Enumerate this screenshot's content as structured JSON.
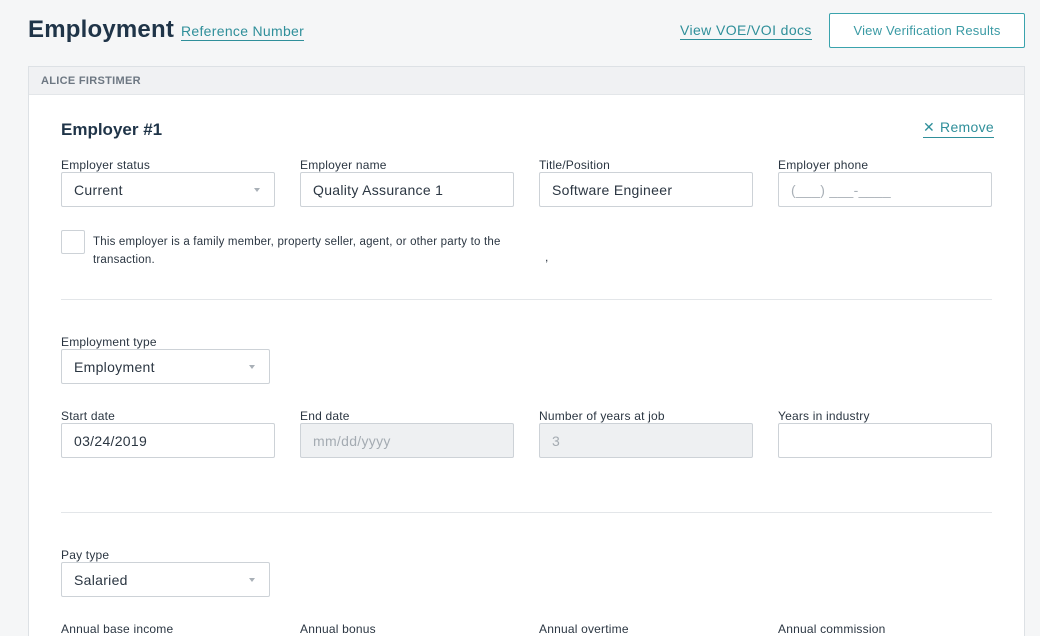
{
  "header": {
    "title": "Employment",
    "reference_link": "Reference Number",
    "voe_link": "View VOE/VOI docs",
    "verification_button": "View Verification Results"
  },
  "borrower": {
    "name": "ALICE FIRSTIMER"
  },
  "employer": {
    "title": "Employer #1",
    "remove_label": "Remove",
    "status": {
      "label": "Employer status",
      "value": "Current"
    },
    "name": {
      "label": "Employer name",
      "value": "Quality Assurance 1"
    },
    "position": {
      "label": "Title/Position",
      "value": "Software Engineer"
    },
    "phone": {
      "label": "Employer phone",
      "placeholder": "(___) ___-____"
    },
    "family_checkbox": {
      "checked": false,
      "label": "This employer is a family member, property seller, agent, or other party to the transaction."
    },
    "stray_text": ",",
    "employment_type": {
      "label": "Employment type",
      "value": "Employment"
    },
    "start_date": {
      "label": "Start date",
      "value": "03/24/2019"
    },
    "end_date": {
      "label": "End date",
      "placeholder": "mm/dd/yyyy"
    },
    "years_at_job": {
      "label": "Number of years at job",
      "value": "3"
    },
    "years_in_industry": {
      "label": "Years in industry",
      "value": ""
    },
    "pay_type": {
      "label": "Pay type",
      "value": "Salaried"
    },
    "annual_base_income": {
      "label": "Annual base income"
    },
    "annual_bonus": {
      "label": "Annual bonus"
    },
    "annual_overtime": {
      "label": "Annual overtime"
    },
    "annual_commission": {
      "label": "Annual commission"
    }
  },
  "colors": {
    "accent": "#2f8f9a",
    "title": "#1f3448",
    "border": "#cdd2d7",
    "disabled_bg": "#eef0f2"
  }
}
